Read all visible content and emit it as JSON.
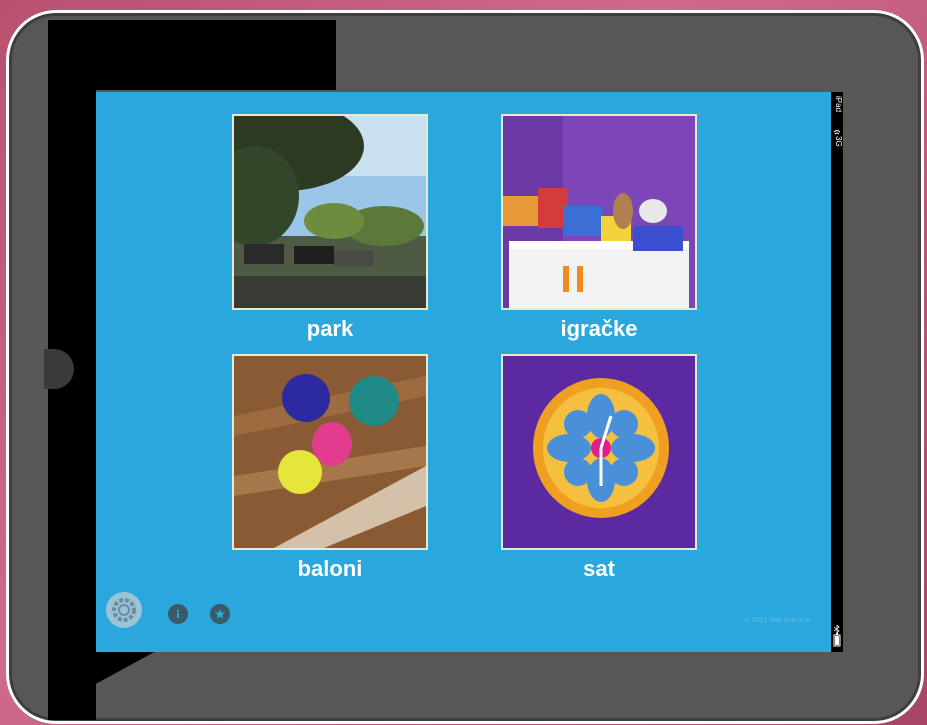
{
  "device": {
    "name": "iPad",
    "network": "3G"
  },
  "tiles": [
    {
      "label": "park",
      "image": "park-photo"
    },
    {
      "label": "igračke",
      "image": "toys-photo"
    },
    {
      "label": "baloni",
      "image": "balloons-photo"
    },
    {
      "label": "sat",
      "image": "clock-photo"
    }
  ],
  "footer": {
    "text": "© 2012 Mali kupus.hr"
  },
  "controls": {
    "settings": "gear-icon",
    "info": "info-icon",
    "favorite": "star-icon"
  },
  "colors": {
    "screen_bg": "#2aa7dc",
    "frame": "#575757",
    "tile_border": "#e9e9d0"
  }
}
